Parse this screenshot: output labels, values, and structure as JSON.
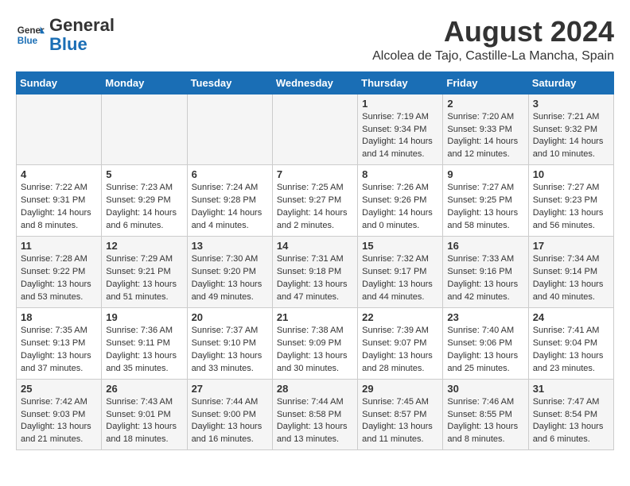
{
  "header": {
    "logo_line1": "General",
    "logo_line2": "Blue",
    "month_year": "August 2024",
    "location": "Alcolea de Tajo, Castille-La Mancha, Spain"
  },
  "weekdays": [
    "Sunday",
    "Monday",
    "Tuesday",
    "Wednesday",
    "Thursday",
    "Friday",
    "Saturday"
  ],
  "weeks": [
    [
      {
        "day": "",
        "info": ""
      },
      {
        "day": "",
        "info": ""
      },
      {
        "day": "",
        "info": ""
      },
      {
        "day": "",
        "info": ""
      },
      {
        "day": "1",
        "info": "Sunrise: 7:19 AM\nSunset: 9:34 PM\nDaylight: 14 hours\nand 14 minutes."
      },
      {
        "day": "2",
        "info": "Sunrise: 7:20 AM\nSunset: 9:33 PM\nDaylight: 14 hours\nand 12 minutes."
      },
      {
        "day": "3",
        "info": "Sunrise: 7:21 AM\nSunset: 9:32 PM\nDaylight: 14 hours\nand 10 minutes."
      }
    ],
    [
      {
        "day": "4",
        "info": "Sunrise: 7:22 AM\nSunset: 9:31 PM\nDaylight: 14 hours\nand 8 minutes."
      },
      {
        "day": "5",
        "info": "Sunrise: 7:23 AM\nSunset: 9:29 PM\nDaylight: 14 hours\nand 6 minutes."
      },
      {
        "day": "6",
        "info": "Sunrise: 7:24 AM\nSunset: 9:28 PM\nDaylight: 14 hours\nand 4 minutes."
      },
      {
        "day": "7",
        "info": "Sunrise: 7:25 AM\nSunset: 9:27 PM\nDaylight: 14 hours\nand 2 minutes."
      },
      {
        "day": "8",
        "info": "Sunrise: 7:26 AM\nSunset: 9:26 PM\nDaylight: 14 hours\nand 0 minutes."
      },
      {
        "day": "9",
        "info": "Sunrise: 7:27 AM\nSunset: 9:25 PM\nDaylight: 13 hours\nand 58 minutes."
      },
      {
        "day": "10",
        "info": "Sunrise: 7:27 AM\nSunset: 9:23 PM\nDaylight: 13 hours\nand 56 minutes."
      }
    ],
    [
      {
        "day": "11",
        "info": "Sunrise: 7:28 AM\nSunset: 9:22 PM\nDaylight: 13 hours\nand 53 minutes."
      },
      {
        "day": "12",
        "info": "Sunrise: 7:29 AM\nSunset: 9:21 PM\nDaylight: 13 hours\nand 51 minutes."
      },
      {
        "day": "13",
        "info": "Sunrise: 7:30 AM\nSunset: 9:20 PM\nDaylight: 13 hours\nand 49 minutes."
      },
      {
        "day": "14",
        "info": "Sunrise: 7:31 AM\nSunset: 9:18 PM\nDaylight: 13 hours\nand 47 minutes."
      },
      {
        "day": "15",
        "info": "Sunrise: 7:32 AM\nSunset: 9:17 PM\nDaylight: 13 hours\nand 44 minutes."
      },
      {
        "day": "16",
        "info": "Sunrise: 7:33 AM\nSunset: 9:16 PM\nDaylight: 13 hours\nand 42 minutes."
      },
      {
        "day": "17",
        "info": "Sunrise: 7:34 AM\nSunset: 9:14 PM\nDaylight: 13 hours\nand 40 minutes."
      }
    ],
    [
      {
        "day": "18",
        "info": "Sunrise: 7:35 AM\nSunset: 9:13 PM\nDaylight: 13 hours\nand 37 minutes."
      },
      {
        "day": "19",
        "info": "Sunrise: 7:36 AM\nSunset: 9:11 PM\nDaylight: 13 hours\nand 35 minutes."
      },
      {
        "day": "20",
        "info": "Sunrise: 7:37 AM\nSunset: 9:10 PM\nDaylight: 13 hours\nand 33 minutes."
      },
      {
        "day": "21",
        "info": "Sunrise: 7:38 AM\nSunset: 9:09 PM\nDaylight: 13 hours\nand 30 minutes."
      },
      {
        "day": "22",
        "info": "Sunrise: 7:39 AM\nSunset: 9:07 PM\nDaylight: 13 hours\nand 28 minutes."
      },
      {
        "day": "23",
        "info": "Sunrise: 7:40 AM\nSunset: 9:06 PM\nDaylight: 13 hours\nand 25 minutes."
      },
      {
        "day": "24",
        "info": "Sunrise: 7:41 AM\nSunset: 9:04 PM\nDaylight: 13 hours\nand 23 minutes."
      }
    ],
    [
      {
        "day": "25",
        "info": "Sunrise: 7:42 AM\nSunset: 9:03 PM\nDaylight: 13 hours\nand 21 minutes."
      },
      {
        "day": "26",
        "info": "Sunrise: 7:43 AM\nSunset: 9:01 PM\nDaylight: 13 hours\nand 18 minutes."
      },
      {
        "day": "27",
        "info": "Sunrise: 7:44 AM\nSunset: 9:00 PM\nDaylight: 13 hours\nand 16 minutes."
      },
      {
        "day": "28",
        "info": "Sunrise: 7:44 AM\nSunset: 8:58 PM\nDaylight: 13 hours\nand 13 minutes."
      },
      {
        "day": "29",
        "info": "Sunrise: 7:45 AM\nSunset: 8:57 PM\nDaylight: 13 hours\nand 11 minutes."
      },
      {
        "day": "30",
        "info": "Sunrise: 7:46 AM\nSunset: 8:55 PM\nDaylight: 13 hours\nand 8 minutes."
      },
      {
        "day": "31",
        "info": "Sunrise: 7:47 AM\nSunset: 8:54 PM\nDaylight: 13 hours\nand 6 minutes."
      }
    ]
  ]
}
